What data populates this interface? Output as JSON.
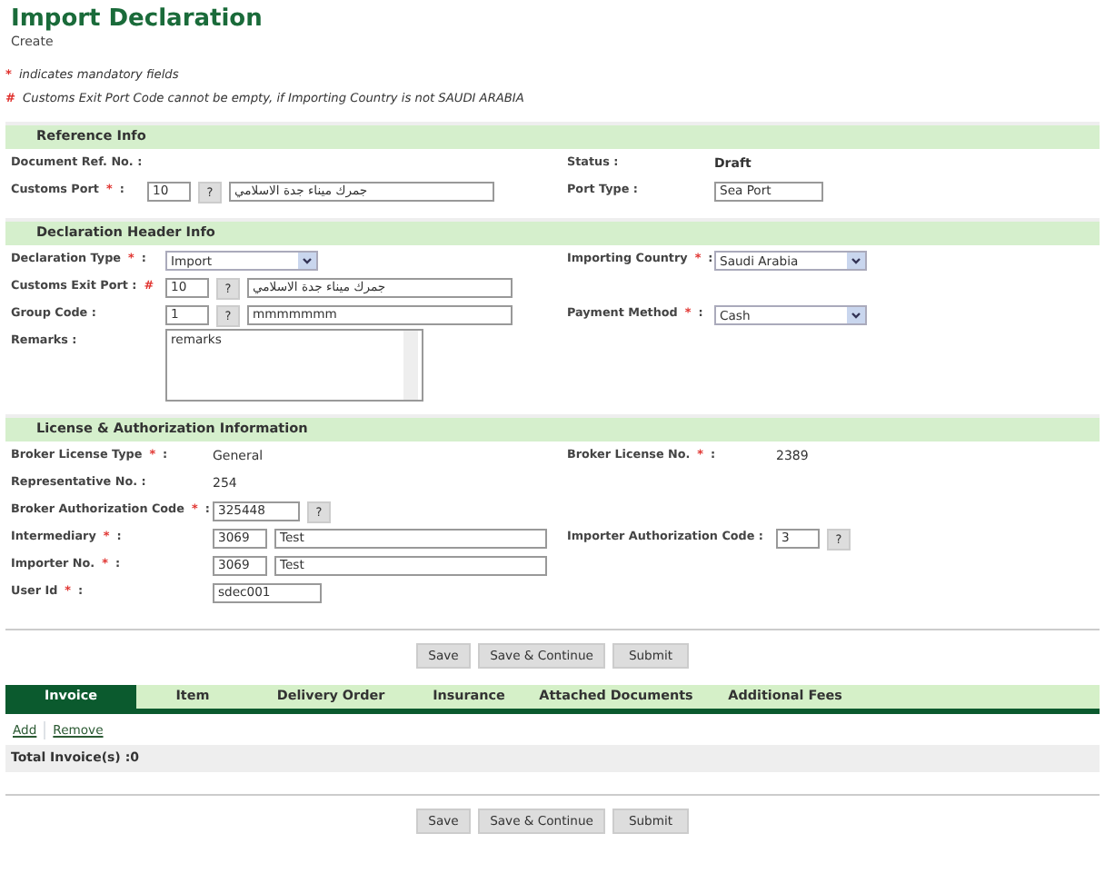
{
  "title": "Import Declaration",
  "subtitle": "Create",
  "notes": [
    {
      "marker": "*",
      "text": "indicates mandatory fields"
    },
    {
      "marker": "#",
      "text": "Customs Exit Port Code cannot be empty, if Importing Country is not SAUDI ARABIA"
    }
  ],
  "sections": [
    {
      "header": "Reference Info",
      "rows": [
        {
          "left": {
            "label": "Document Ref. No. :",
            "kind": "value"
          },
          "right": {
            "label": "Status :",
            "kind": "value",
            "value": "Draft",
            "bold": true
          }
        },
        {
          "left": {
            "label": "Customs Port",
            "marker": "*",
            "after": ":",
            "kind": "lookup",
            "code": "10",
            "help": "?",
            "name": "جمرك ميناء جدة الاسلامي"
          },
          "right": {
            "label": "Port Type :",
            "kind": "input",
            "value": "Sea Port"
          }
        }
      ]
    },
    {
      "header": "Declaration Header Info",
      "rows": [
        {
          "left": {
            "label": "Declaration Type",
            "marker": "*",
            "after": ":",
            "kind": "select",
            "value": "Import"
          },
          "right": {
            "label": "Importing Country",
            "marker": "*",
            "after": ":",
            "kind": "select",
            "value": "Saudi Arabia"
          }
        },
        {
          "left": {
            "label": "Customs Exit Port :",
            "marker": "#",
            "kind": "lookup",
            "code": "10",
            "help": "?",
            "name": "جمرك ميناء جدة الاسلامي"
          }
        },
        {
          "left": {
            "label": "Group Code :",
            "kind": "lookup",
            "code": "1",
            "help": "?",
            "name": "mmmmmmm"
          },
          "right": {
            "label": "Payment Method",
            "marker": "*",
            "after": ":",
            "kind": "select",
            "value": "Cash"
          }
        },
        {
          "left": {
            "label": "Remarks :",
            "kind": "textarea",
            "value": "remarks"
          }
        }
      ]
    },
    {
      "header": "License & Authorization Information",
      "rows": [
        {
          "left": {
            "label": "Broker License Type",
            "marker": "*",
            "after": ":",
            "kind": "value",
            "value": "General"
          },
          "right": {
            "label": "Broker License No.",
            "marker": "*",
            "after": ":",
            "kind": "value",
            "value": "2389"
          }
        },
        {
          "left": {
            "label": "Representative No. :",
            "kind": "value",
            "value": "254"
          }
        },
        {
          "left": {
            "label": "Broker Authorization Code",
            "marker": "*",
            "after": ":",
            "kind": "lookup",
            "code": "325448",
            "help": "?"
          }
        },
        {
          "left": {
            "label": "Intermediary",
            "marker": "*",
            "after": ":",
            "kind": "lookup",
            "code": "3069",
            "name": "Test"
          },
          "right": {
            "label": "Importer Authorization Code :",
            "kind": "lookup",
            "code": "3",
            "help": "?"
          }
        },
        {
          "left": {
            "label": "Importer No.",
            "marker": "*",
            "after": ":",
            "kind": "lookup",
            "code": "3069",
            "name": "Test"
          }
        },
        {
          "left": {
            "label": "User Id",
            "marker": "*",
            "after": ":",
            "kind": "input",
            "value": "sdec001"
          }
        }
      ]
    }
  ],
  "buttons": [
    "Save",
    "Save & Continue",
    "Submit"
  ],
  "tabs": [
    {
      "label": "Invoice",
      "selected": true
    },
    {
      "label": "Item",
      "selected": false
    },
    {
      "label": "Delivery Order",
      "selected": false
    },
    {
      "label": "Insurance",
      "selected": false
    },
    {
      "label": "Attached Documents",
      "selected": false
    },
    {
      "label": "Additional Fees",
      "selected": false
    }
  ],
  "links": [
    "Add",
    "Remove"
  ],
  "total": "Total Invoice(s) :0",
  "bottom_buttons": [
    "Save",
    "Save & Continue",
    "Submit"
  ]
}
